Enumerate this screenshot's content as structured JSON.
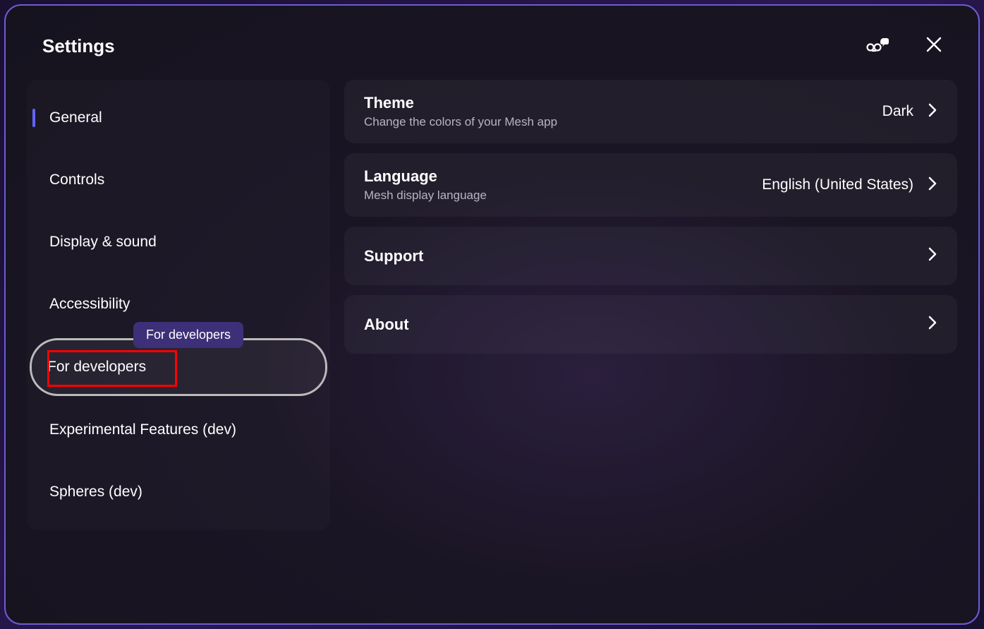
{
  "header": {
    "title": "Settings"
  },
  "sidebar": {
    "items": [
      {
        "label": "General",
        "active": true
      },
      {
        "label": "Controls"
      },
      {
        "label": "Display & sound"
      },
      {
        "label": "Accessibility"
      },
      {
        "label": "For developers",
        "hovered": true
      },
      {
        "label": "Experimental Features (dev)"
      },
      {
        "label": "Spheres (dev)"
      }
    ]
  },
  "tooltip": {
    "text": "For developers"
  },
  "main": {
    "items": [
      {
        "title": "Theme",
        "desc": "Change the colors of your Mesh app",
        "value": "Dark"
      },
      {
        "title": "Language",
        "desc": "Mesh display language",
        "value": "English (United States)"
      },
      {
        "title": "Support"
      },
      {
        "title": "About"
      }
    ]
  }
}
